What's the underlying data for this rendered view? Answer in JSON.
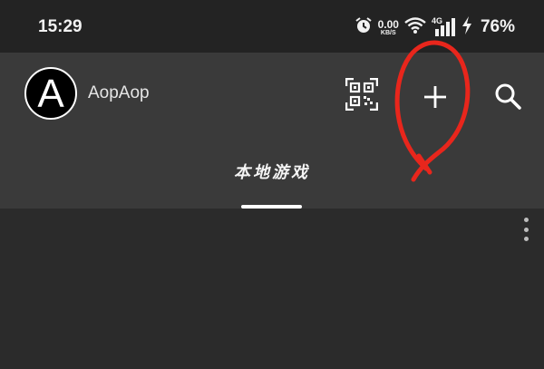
{
  "status_bar": {
    "time": "15:29",
    "net_speed_value": "0.00",
    "net_speed_unit": "KB/S",
    "network_type": "4G",
    "battery": "76%",
    "icons": [
      "alarm-icon",
      "wifi-icon",
      "signal-icon",
      "charging-icon"
    ]
  },
  "header": {
    "avatar_letter": "A",
    "username": "AopAop",
    "actions": [
      "qr-code-icon",
      "add-icon",
      "search-icon"
    ]
  },
  "tabs": [
    {
      "label": "本地游戏",
      "selected": true
    }
  ],
  "annotation": {
    "color": "#e8261c"
  },
  "colors": {
    "status_bar_bg": "#232323",
    "app_bar_bg": "#3a3a3a",
    "content_bg": "#2b2b2b",
    "tab_indicator": "#ffffff"
  }
}
